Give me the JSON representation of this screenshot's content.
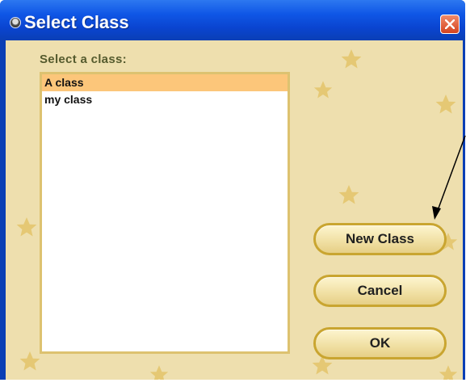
{
  "window": {
    "title": "Select Class",
    "icon": "app-icon",
    "close_icon": "close-icon"
  },
  "list": {
    "label": "Select a class:",
    "items": [
      {
        "label": "A class",
        "selected": true
      },
      {
        "label": "my class",
        "selected": false
      }
    ]
  },
  "buttons": {
    "new_class": "New Class",
    "cancel": "Cancel",
    "ok": "OK"
  },
  "colors": {
    "title_bar": "#0a44cf",
    "panel": "#eedfae",
    "selection": "#fcc67a",
    "button_border": "#c9a530",
    "star": "#e3c56a"
  }
}
